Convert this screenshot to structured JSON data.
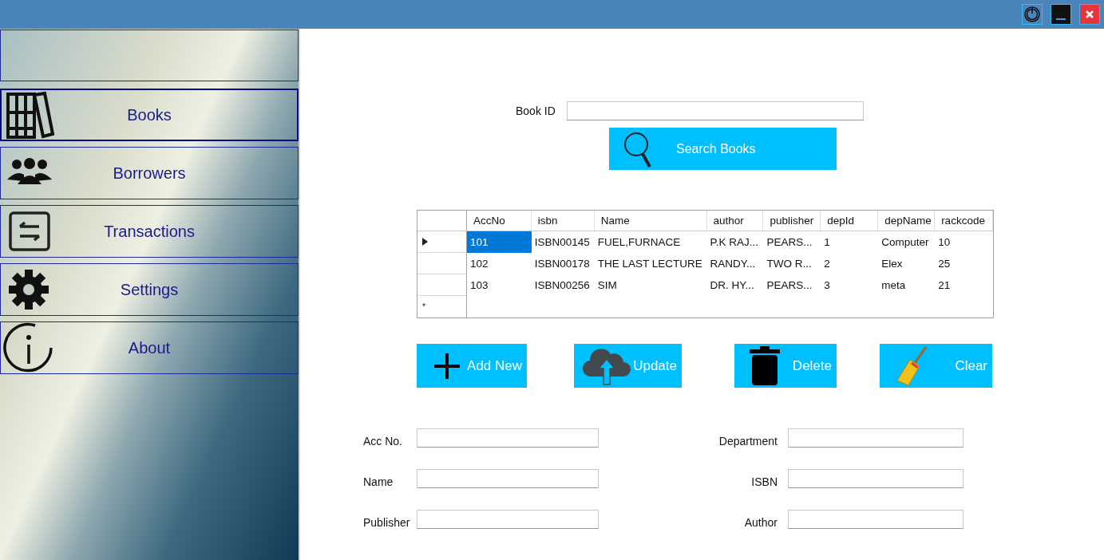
{
  "nav": {
    "items": [
      {
        "label": "Books",
        "kind": "books",
        "selected": true
      },
      {
        "label": "Borrowers",
        "kind": "people",
        "selected": false
      },
      {
        "label": "Transactions",
        "kind": "transfer",
        "selected": false
      },
      {
        "label": "Settings",
        "kind": "gear",
        "selected": false
      },
      {
        "label": "About",
        "kind": "info",
        "selected": false
      }
    ]
  },
  "search": {
    "label": "Book ID",
    "button": "Search Books"
  },
  "table": {
    "columns": [
      "AccNo",
      "isbn",
      "Name",
      "author",
      "publisher",
      "depId",
      "depName",
      "rackcode"
    ],
    "rows": [
      {
        "current": true,
        "cells": [
          "101",
          "ISBN00145",
          "FUEL,FURNACE",
          "P.K RAJ...",
          "PEARS...",
          "1",
          "Computer",
          "10"
        ]
      },
      {
        "current": false,
        "cells": [
          "102",
          "ISBN00178",
          "THE LAST LECTURE",
          "RANDY...",
          "TWO R...",
          "2",
          "Elex",
          "25"
        ]
      },
      {
        "current": false,
        "cells": [
          "103",
          "ISBN00256",
          "SIM",
          "DR. HY...",
          "PEARS...",
          "3",
          "meta",
          "21"
        ]
      }
    ],
    "new_row_marker": "*"
  },
  "actions": [
    {
      "label": "Add New",
      "kind": "add"
    },
    {
      "label": "Update",
      "kind": "upload"
    },
    {
      "label": "Delete",
      "kind": "delete"
    },
    {
      "label": "Clear",
      "kind": "clear"
    }
  ],
  "form": {
    "left": [
      "Acc No.",
      "Name",
      "Publisher"
    ],
    "right": [
      "Department",
      "ISBN",
      "Author"
    ]
  }
}
